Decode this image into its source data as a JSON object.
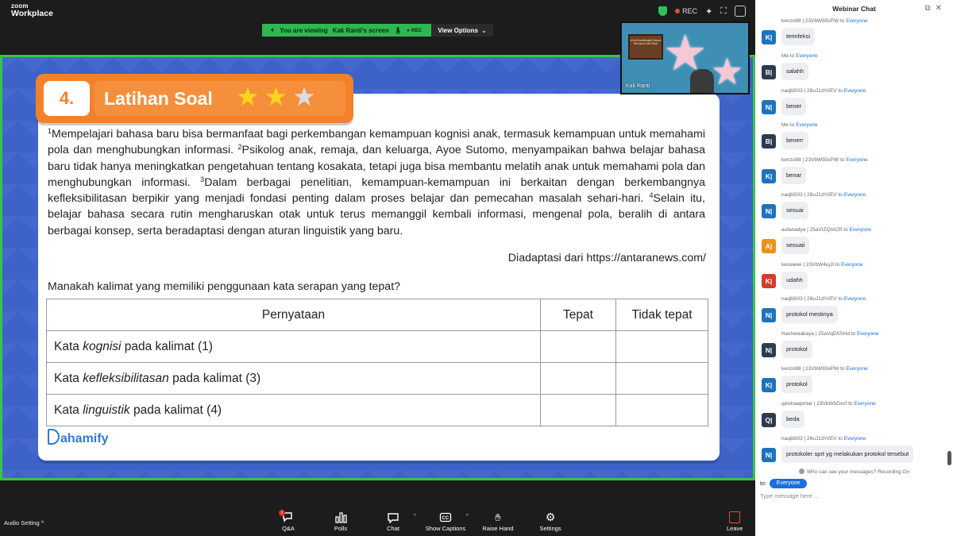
{
  "app": {
    "logo_top": "zoom",
    "logo_bottom": "Workplace"
  },
  "topbar": {
    "rec_label": "REC"
  },
  "banner": {
    "viewing_text": "You are viewing",
    "presenter": "Kak Ranti's screen",
    "rec_label": "REC",
    "view_options": "View Options"
  },
  "slide": {
    "number": "4.",
    "title": "Latihan Soal",
    "stars_filled": 2,
    "stars_total": 3,
    "passage": [
      {
        "sup": "1",
        "text": "Mempelajari bahasa baru bisa bermanfaat bagi perkembangan kemampuan kognisi anak, termasuk kemampuan untuk memahami pola dan menghubungkan informasi. "
      },
      {
        "sup": "2",
        "text": "Psikolog anak, remaja, dan keluarga, Ayoe Sutomo, menyampaikan bahwa belajar bahasa baru tidak hanya meningkatkan pengetahuan tentang kosakata, tetapi juga bisa membantu melatih anak untuk memahami pola dan menghubungkan informasi. "
      },
      {
        "sup": "3",
        "text": "Dalam berbagai penelitian, kemampuan-kemampuan ini berkaitan dengan berkembangnya kefleksibilitasan berpikir yang menjadi fondasi penting dalam proses belajar dan pemecahan masalah sehari-hari. "
      },
      {
        "sup": "4",
        "text": "Selain itu, belajar bahasa secara rutin mengharuskan otak untuk terus memanggil kembali informasi, mengenal pola, beralih di antara berbagai konsep, serta beradaptasi dengan aturan linguistik yang baru."
      }
    ],
    "source": "Diadaptasi dari https://antaranews.com/",
    "question": "Manakah kalimat yang memiliki penggunaan kata serapan yang tepat?",
    "table": {
      "headers": [
        "Pernyataan",
        "Tepat",
        "Tidak tepat"
      ],
      "rows": [
        {
          "prefix": "Kata ",
          "term": "kognisi",
          "suffix": " pada kalimat (1)"
        },
        {
          "prefix": "Kata ",
          "term": "kefleksibilitasan",
          "suffix": " pada kalimat (3)"
        },
        {
          "prefix": "Kata ",
          "term": "linguistik",
          "suffix": " pada kalimat (4)"
        }
      ]
    },
    "brand": "ahamify"
  },
  "speaker": {
    "name": "Kak Ranti",
    "sign_text": "#CeriCaraBelajarPahami Bersama Kak Ranti"
  },
  "bottombar": {
    "audio_setting": "Audio Setting",
    "tools": [
      {
        "label": "Q&A",
        "badge": "1"
      },
      {
        "label": "Polls"
      },
      {
        "label": "Chat"
      },
      {
        "label": "Show Captions"
      },
      {
        "label": "Raise Hand"
      },
      {
        "label": "Settings"
      }
    ],
    "leave": "Leave"
  },
  "chat": {
    "title": "Webinar Chat",
    "messages": [
      {
        "sender": "kenzo88 | 23VbW93xPW",
        "to": "to",
        "recipient": "Everyone",
        "initial": "K|",
        "color": "#1e73be",
        "text": "terinfeksi"
      },
      {
        "sender": "Me",
        "to": "to",
        "recipient": "Everyone",
        "initial": "B|",
        "color": "#2d3b4e",
        "text": "salahh"
      },
      {
        "sender": "naqib503 | 26uJ1zhVEV",
        "to": "to",
        "recipient": "Everyone",
        "initial": "N|",
        "color": "#1e73be",
        "text": "bener"
      },
      {
        "sender": "Me",
        "to": "to",
        "recipient": "Everyone",
        "initial": "B|",
        "color": "#2d3b4e",
        "text": "benerr"
      },
      {
        "sender": "kenzo88 | 23VbW93xPW",
        "to": "to",
        "recipient": "Everyone",
        "initial": "K|",
        "color": "#1e73be",
        "text": "benar"
      },
      {
        "sender": "naqib503 | 26uJ1zhVEV",
        "to": "to",
        "recipient": "Everyone",
        "initial": "N|",
        "color": "#1e73be",
        "text": "sesuai"
      },
      {
        "sender": "aufanadya | 25aVIZQmCR",
        "to": "to",
        "recipient": "Everyone",
        "initial": "A|",
        "color": "#e8941a",
        "text": "sesuaii"
      },
      {
        "sender": "kessieee | 23VbW4ujJI",
        "to": "to",
        "recipient": "Everyone",
        "initial": "K|",
        "color": "#d23b2e",
        "text": "udahh"
      },
      {
        "sender": "naqib503 | 26uJ1zhVEV",
        "to": "to",
        "recipient": "Everyone",
        "initial": "N|",
        "color": "#1e73be",
        "text": "protokol mestinya"
      },
      {
        "sender": "Nashwaakaya | 25aVqD5SHd",
        "to": "to",
        "recipient": "Everyone",
        "initial": "N|",
        "color": "#2d3b4e",
        "text": "protokol"
      },
      {
        "sender": "kenzo88 | 23VbW93xPW",
        "to": "to",
        "recipient": "Everyone",
        "initial": "K|",
        "color": "#1e73be",
        "text": "protokol"
      },
      {
        "sender": "qeishaapintar | 23VbW5Dxcf",
        "to": "to",
        "recipient": "Everyone",
        "initial": "Q|",
        "color": "#2d3b4e",
        "text": "beda"
      },
      {
        "sender": "naqib503 | 26uJ1zhVEV",
        "to": "to",
        "recipient": "Everyone",
        "initial": "N|",
        "color": "#1e73be",
        "text": "protokoler sprt yg melakukan protokol tersebut"
      }
    ],
    "privacy_note": "Who can see your messages? Recording On",
    "to_label": "to:",
    "to_value": "Everyone",
    "input_placeholder": "Type message here ..."
  }
}
